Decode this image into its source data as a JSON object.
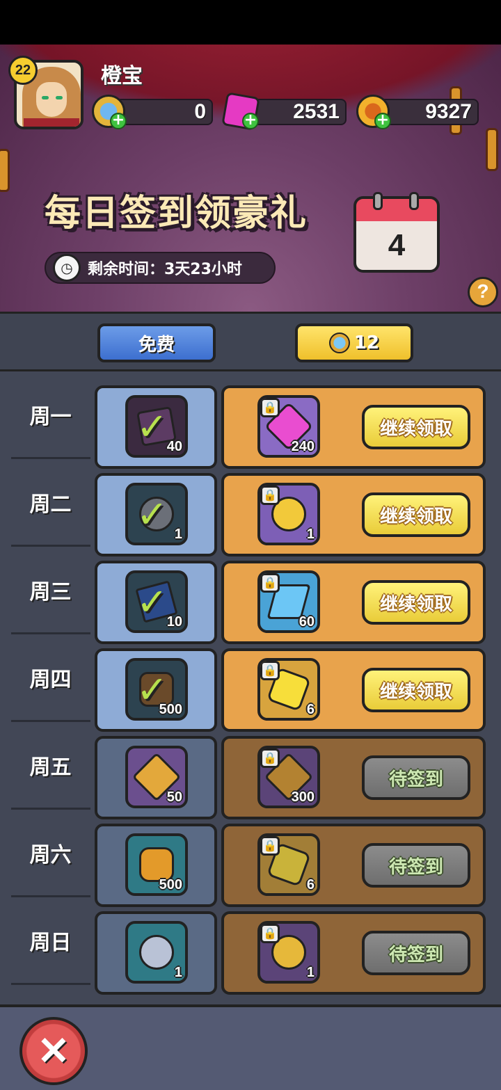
{
  "player": {
    "level": "22",
    "name": "橙宝"
  },
  "currencies": [
    {
      "name": "diamond-coin",
      "value": "0",
      "color": "#6fb7f0"
    },
    {
      "name": "pink-gem",
      "value": "2531",
      "color": "#e53ac3"
    },
    {
      "name": "gold-coin",
      "value": "9327",
      "color": "#f2b12c"
    }
  ],
  "banner": {
    "title": "每日签到领豪礼",
    "timer_label": "剩余时间：3天23小时",
    "calendar_day": "4",
    "help_label": "?"
  },
  "tabs": {
    "free_label": "免费",
    "premium_value": "12"
  },
  "rows": [
    {
      "day": "周一",
      "free": {
        "icon": "ticket-icon",
        "qty": "40",
        "claimed": true
      },
      "premium": {
        "icon": "pink-gem-icon",
        "qty": "240"
      },
      "button": "继续领取",
      "status": "claimable"
    },
    {
      "day": "周二",
      "free": {
        "icon": "key-icon",
        "qty": "1",
        "claimed": true
      },
      "premium": {
        "icon": "gold-key-icon",
        "qty": "1"
      },
      "button": "继续领取",
      "status": "claimable"
    },
    {
      "day": "周三",
      "free": {
        "icon": "card-icon",
        "qty": "10",
        "claimed": true
      },
      "premium": {
        "icon": "lightning-icon",
        "qty": "60"
      },
      "button": "继续领取",
      "status": "claimable"
    },
    {
      "day": "周四",
      "free": {
        "icon": "coin-icon",
        "qty": "500",
        "claimed": true
      },
      "premium": {
        "icon": "gold-gem-icon",
        "qty": "6"
      },
      "button": "继续领取",
      "status": "claimable"
    },
    {
      "day": "周五",
      "free": {
        "icon": "puzzle-icon",
        "qty": "50",
        "claimed": false
      },
      "premium": {
        "icon": "puzzle-icon",
        "qty": "300"
      },
      "button": "待签到",
      "status": "pending"
    },
    {
      "day": "周六",
      "free": {
        "icon": "coin-icon",
        "qty": "500",
        "claimed": false
      },
      "premium": {
        "icon": "gold-gem-icon",
        "qty": "6"
      },
      "button": "待签到",
      "status": "pending"
    },
    {
      "day": "周日",
      "free": {
        "icon": "silver-key-icon",
        "qty": "1",
        "claimed": false
      },
      "premium": {
        "icon": "gold-key-icon",
        "qty": "1"
      },
      "button": "待签到",
      "status": "pending"
    }
  ],
  "close_label": "✕"
}
